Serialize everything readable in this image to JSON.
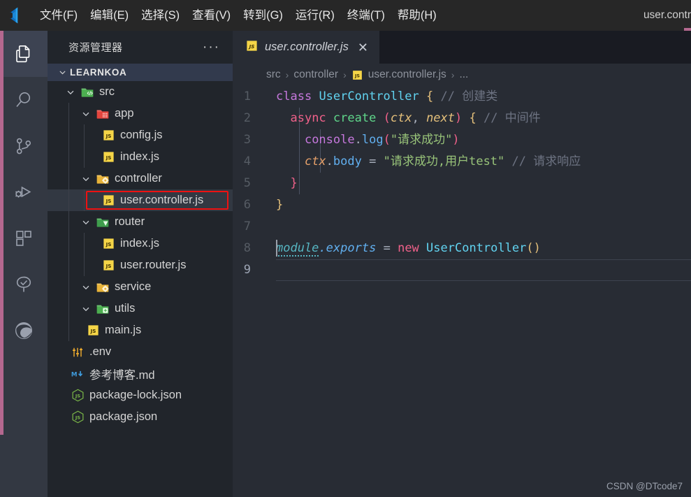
{
  "titlebar": {
    "logo_icon": "vscode-logo-icon",
    "menu": [
      {
        "label": "文件(F)"
      },
      {
        "label": "编辑(E)"
      },
      {
        "label": "选择(S)"
      },
      {
        "label": "查看(V)"
      },
      {
        "label": "转到(G)"
      },
      {
        "label": "运行(R)"
      },
      {
        "label": "终端(T)"
      },
      {
        "label": "帮助(H)"
      }
    ],
    "window_title": "user.contr",
    "accent_color": "#b4688f"
  },
  "activitybar": {
    "items": [
      {
        "icon": "explorer-files-icon",
        "name": "explorer",
        "active": true
      },
      {
        "icon": "search-icon",
        "name": "search",
        "active": false
      },
      {
        "icon": "source-control-branch-icon",
        "name": "source-control",
        "active": false
      },
      {
        "icon": "run-and-debug-icon",
        "name": "run-debug",
        "active": false
      },
      {
        "icon": "extensions-blocks-icon",
        "name": "extensions",
        "active": false
      },
      {
        "icon": "testing-beaker-tree-icon",
        "name": "testing",
        "active": false
      },
      {
        "icon": "edge-browser-icon",
        "name": "browser-preview",
        "active": false
      }
    ]
  },
  "sidebar": {
    "title": "资源管理器",
    "more_actions_label": "···",
    "root": {
      "label": "LEARNKOA",
      "expanded": true
    },
    "tree": [
      {
        "label": "src",
        "type": "folder",
        "icon": "folder-src-icon",
        "depth": 1,
        "expanded": true
      },
      {
        "label": "app",
        "type": "folder",
        "icon": "folder-app-icon",
        "depth": 2,
        "expanded": true
      },
      {
        "label": "config.js",
        "type": "file",
        "icon": "js-file-icon",
        "depth": 3
      },
      {
        "label": "index.js",
        "type": "file",
        "icon": "js-file-icon",
        "depth": 3
      },
      {
        "label": "controller",
        "type": "folder",
        "icon": "folder-controller-icon",
        "depth": 2,
        "expanded": true
      },
      {
        "label": "user.controller.js",
        "type": "file",
        "icon": "js-file-icon",
        "depth": 3,
        "selected": true,
        "annotated": true
      },
      {
        "label": "router",
        "type": "folder",
        "icon": "folder-router-icon",
        "depth": 2,
        "expanded": true
      },
      {
        "label": "index.js",
        "type": "file",
        "icon": "js-file-icon",
        "depth": 3
      },
      {
        "label": "user.router.js",
        "type": "file",
        "icon": "js-file-icon",
        "depth": 3
      },
      {
        "label": "service",
        "type": "folder",
        "icon": "folder-service-icon",
        "depth": 2,
        "expanded": true
      },
      {
        "label": "utils",
        "type": "folder",
        "icon": "folder-utils-icon",
        "depth": 2,
        "expanded": true
      },
      {
        "label": "main.js",
        "type": "file",
        "icon": "js-file-icon",
        "depth": 2
      },
      {
        "label": ".env",
        "type": "file",
        "icon": "env-settings-icon",
        "depth": 1
      },
      {
        "label": "参考博客.md",
        "type": "file",
        "icon": "markdown-icon",
        "depth": 1
      },
      {
        "label": "package-lock.json",
        "type": "file",
        "icon": "nodejs-hex-icon",
        "depth": 1
      },
      {
        "label": "package.json",
        "type": "file",
        "icon": "nodejs-hex-icon",
        "depth": 1
      }
    ],
    "annotation_color": "#ee1111"
  },
  "editor": {
    "tab": {
      "label": "user.controller.js",
      "icon": "js-file-icon",
      "close_label": "✕",
      "preview_italic": true
    },
    "breadcrumb": [
      {
        "label": "src",
        "icon": null
      },
      {
        "label": "controller",
        "icon": null
      },
      {
        "label": "user.controller.js",
        "icon": "js-file-icon"
      },
      {
        "label": "...",
        "icon": null
      }
    ],
    "breadcrumb_separator": "›",
    "active_line": 9,
    "lines": [
      {
        "n": "1",
        "plain": "class UserController { // 创建类"
      },
      {
        "n": "2",
        "plain": "  async create (ctx, next) { // 中间件"
      },
      {
        "n": "3",
        "plain": "    console.log(\"请求成功\")"
      },
      {
        "n": "4",
        "plain": "    ctx.body = \"请求成功,用户test\" // 请求响应"
      },
      {
        "n": "5",
        "plain": "  }"
      },
      {
        "n": "6",
        "plain": "}"
      },
      {
        "n": "7",
        "plain": ""
      },
      {
        "n": "8",
        "plain": "module.exports = new UserController()"
      },
      {
        "n": "9",
        "plain": ""
      }
    ],
    "tokens": {
      "kw_class": "class",
      "name_UserController": "UserController",
      "brace_open_1": "{",
      "comment_1": "// 创建类",
      "kw_async": "async",
      "fn_create": "create",
      "paren_open": "(",
      "param_ctx": "ctx",
      "comma": ",",
      "param_next": "next",
      "paren_close": ")",
      "brace_open_2": "{",
      "comment_2": "// 中间件",
      "obj_console": "console",
      "dot": ".",
      "prop_log": "log",
      "str_1": "\"请求成功\"",
      "var_ctx": "ctx",
      "prop_body": "body",
      "equals": "=",
      "str_2": "\"请求成功,用户test\"",
      "comment_3": "// 请求响应",
      "brace_close_inner": "}",
      "brace_close_outer": "}",
      "mod_module": "module",
      "prop_exports": "exports",
      "kw_new": "new",
      "call_UserController": "UserController",
      "parens_empty": "()"
    }
  },
  "watermark": {
    "text": "CSDN @DTcode7"
  }
}
